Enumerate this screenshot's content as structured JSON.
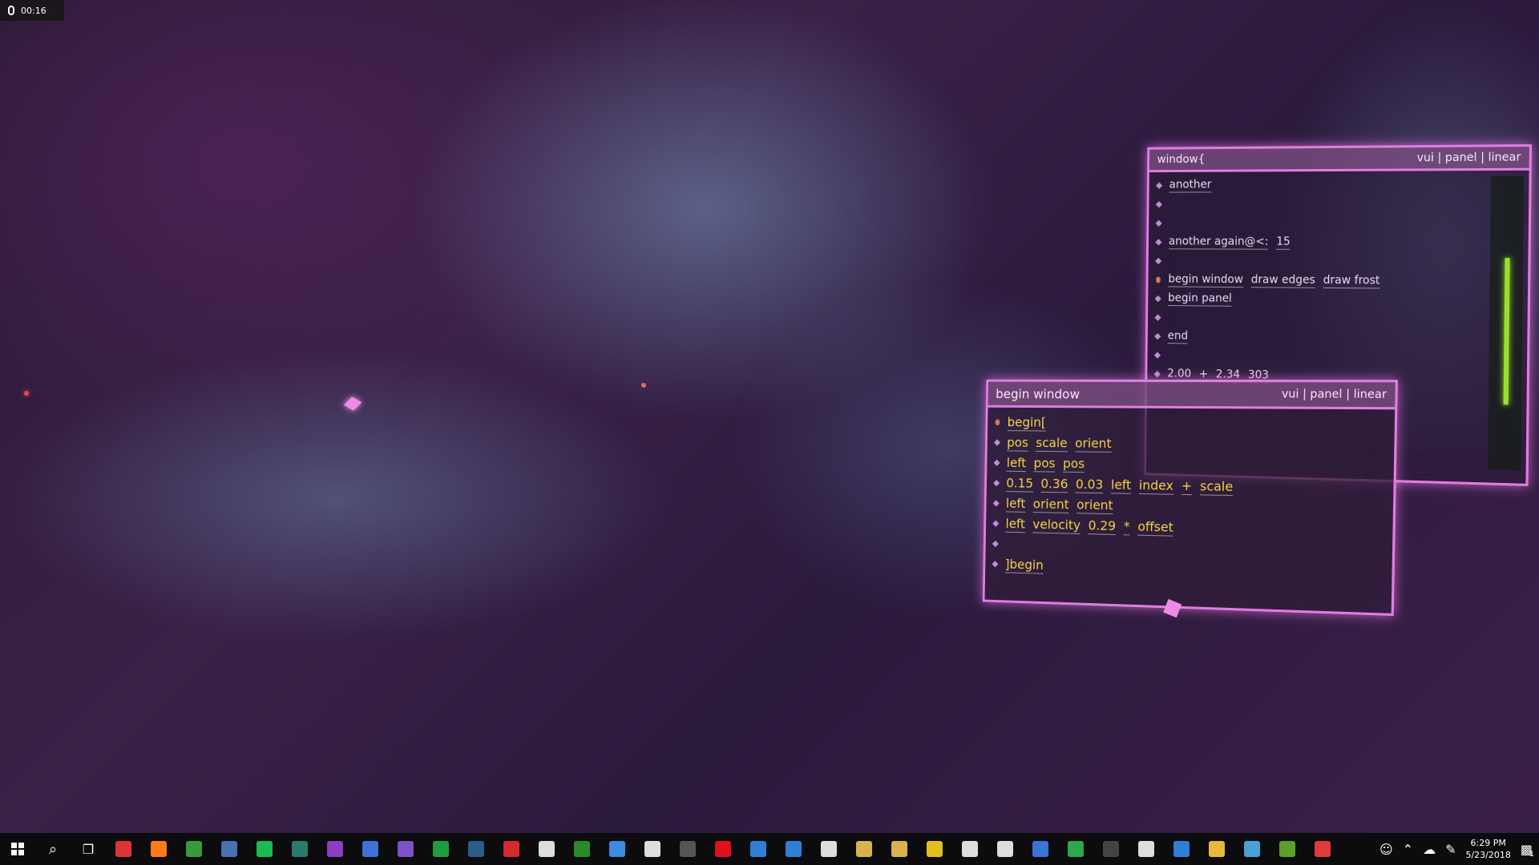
{
  "recording": {
    "time": "00:16"
  },
  "window_panel": {
    "title": "window{",
    "tags": "vui | panel | linear",
    "rows": [
      {
        "tokens": [
          "another"
        ]
      },
      {
        "tokens": []
      },
      {
        "tokens": []
      },
      {
        "tokens": [
          "another again@<:",
          "15"
        ]
      },
      {
        "tokens": []
      },
      {
        "tokens": [
          "begin window",
          "draw edges",
          "draw frost"
        ],
        "active": true
      },
      {
        "tokens": [
          "begin panel"
        ]
      },
      {
        "tokens": []
      },
      {
        "tokens": [
          "end"
        ]
      },
      {
        "tokens": []
      },
      {
        "tokens": [
          "2.00",
          "+",
          "2.34",
          "303"
        ]
      }
    ]
  },
  "begin_window_panel": {
    "title": "begin window",
    "tags": "vui | panel | linear",
    "rows": [
      {
        "tokens": [
          "begin["
        ],
        "active": true
      },
      {
        "tokens": [
          "pos",
          "scale",
          "orient"
        ]
      },
      {
        "tokens": [
          "left",
          "pos",
          "pos"
        ]
      },
      {
        "tokens": [
          "0.15",
          "0.36",
          "0.03",
          "left",
          "index",
          "+",
          "scale"
        ]
      },
      {
        "tokens": [
          "left",
          "orient",
          "orient"
        ]
      },
      {
        "tokens": [
          "left",
          "velocity",
          "0.29",
          "*",
          "offset"
        ]
      },
      {
        "tokens": []
      },
      {
        "tokens": [
          "]begin"
        ]
      }
    ]
  },
  "taskbar": {
    "icons": [
      {
        "name": "start-icon",
        "color": "#ffffff"
      },
      {
        "name": "search-icon",
        "color": "#ffffff"
      },
      {
        "name": "task-view-icon",
        "color": "#ffffff"
      },
      {
        "name": "app-icon",
        "color": "#d33"
      },
      {
        "name": "firefox-icon",
        "color": "#ff7a1a"
      },
      {
        "name": "vim-icon",
        "color": "#3a9a3a"
      },
      {
        "name": "app-icon",
        "color": "#4a6fb3"
      },
      {
        "name": "spotify-icon",
        "color": "#1db954"
      },
      {
        "name": "app-icon",
        "color": "#2b7a6f"
      },
      {
        "name": "onenote-icon",
        "color": "#8a3fc2"
      },
      {
        "name": "app-icon",
        "color": "#3b73d6"
      },
      {
        "name": "visual-studio-icon",
        "color": "#7d52c7"
      },
      {
        "name": "app-icon",
        "color": "#1e9e3f"
      },
      {
        "name": "steam-icon",
        "color": "#2a5d88"
      },
      {
        "name": "app-icon",
        "color": "#d42a2a"
      },
      {
        "name": "oculus-icon",
        "color": "#dddddd"
      },
      {
        "name": "app-icon",
        "color": "#2a8a2a"
      },
      {
        "name": "chat-icon",
        "color": "#3a8de0"
      },
      {
        "name": "oculus-icon",
        "color": "#dddddd"
      },
      {
        "name": "bug-icon",
        "color": "#555555"
      },
      {
        "name": "opera-icon",
        "color": "#e0101e"
      },
      {
        "name": "app-icon",
        "color": "#2f7fd6"
      },
      {
        "name": "app-icon",
        "color": "#2f7fd6"
      },
      {
        "name": "wolf-icon",
        "color": "#dddddd"
      },
      {
        "name": "books-icon",
        "color": "#d9b24a"
      },
      {
        "name": "books-icon",
        "color": "#d9b24a"
      },
      {
        "name": "app-icon",
        "color": "#e0c020"
      },
      {
        "name": "app-icon",
        "color": "#dddddd"
      },
      {
        "name": "app-icon",
        "color": "#dddddd"
      },
      {
        "name": "app-icon",
        "color": "#3b73d6"
      },
      {
        "name": "app-icon",
        "color": "#2da84a"
      },
      {
        "name": "app-icon",
        "color": "#444444"
      },
      {
        "name": "app-icon",
        "color": "#dddddd"
      },
      {
        "name": "vscode-icon",
        "color": "#2f7fd6"
      },
      {
        "name": "folder-icon",
        "color": "#e8b83a"
      },
      {
        "name": "app-icon",
        "color": "#4aa0d8"
      },
      {
        "name": "app-icon",
        "color": "#5aa02a"
      },
      {
        "name": "app-icon",
        "color": "#e03a3a"
      }
    ],
    "clock_time": "6:29 PM",
    "clock_date": "5/23/2018",
    "notification_count": "1"
  }
}
